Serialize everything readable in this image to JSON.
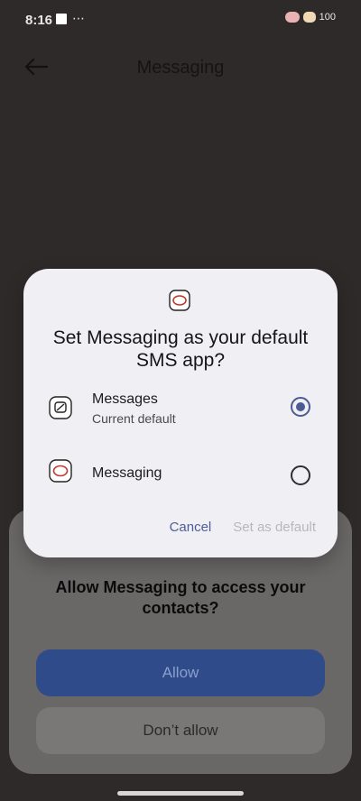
{
  "status_bar": {
    "time": "8:16",
    "dots": "⋯",
    "battery": "100"
  },
  "app_bar": {
    "title": "Messaging"
  },
  "default_sms_dialog": {
    "title": "Set Messaging as your default SMS app?",
    "options": [
      {
        "label": "Messages",
        "sublabel": "Current default",
        "selected": true
      },
      {
        "label": "Messaging",
        "sublabel": "",
        "selected": false
      }
    ],
    "actions": {
      "cancel": "Cancel",
      "set_default": "Set as default"
    }
  },
  "permission_sheet": {
    "title": "Allow Messaging to access your contacts?",
    "allow": "Allow",
    "deny": "Don’t allow"
  },
  "colors": {
    "background": "#2f2a2a",
    "dialog_bg": "#f0eff4",
    "accent": "#4c5b91",
    "disabled_text": "#b8b7bd",
    "allow_button": "#2f4b8a"
  },
  "icons": {
    "back": "arrow-left-icon",
    "messaging_app": "messaging-app-icon",
    "messages_app": "messages-app-icon"
  }
}
